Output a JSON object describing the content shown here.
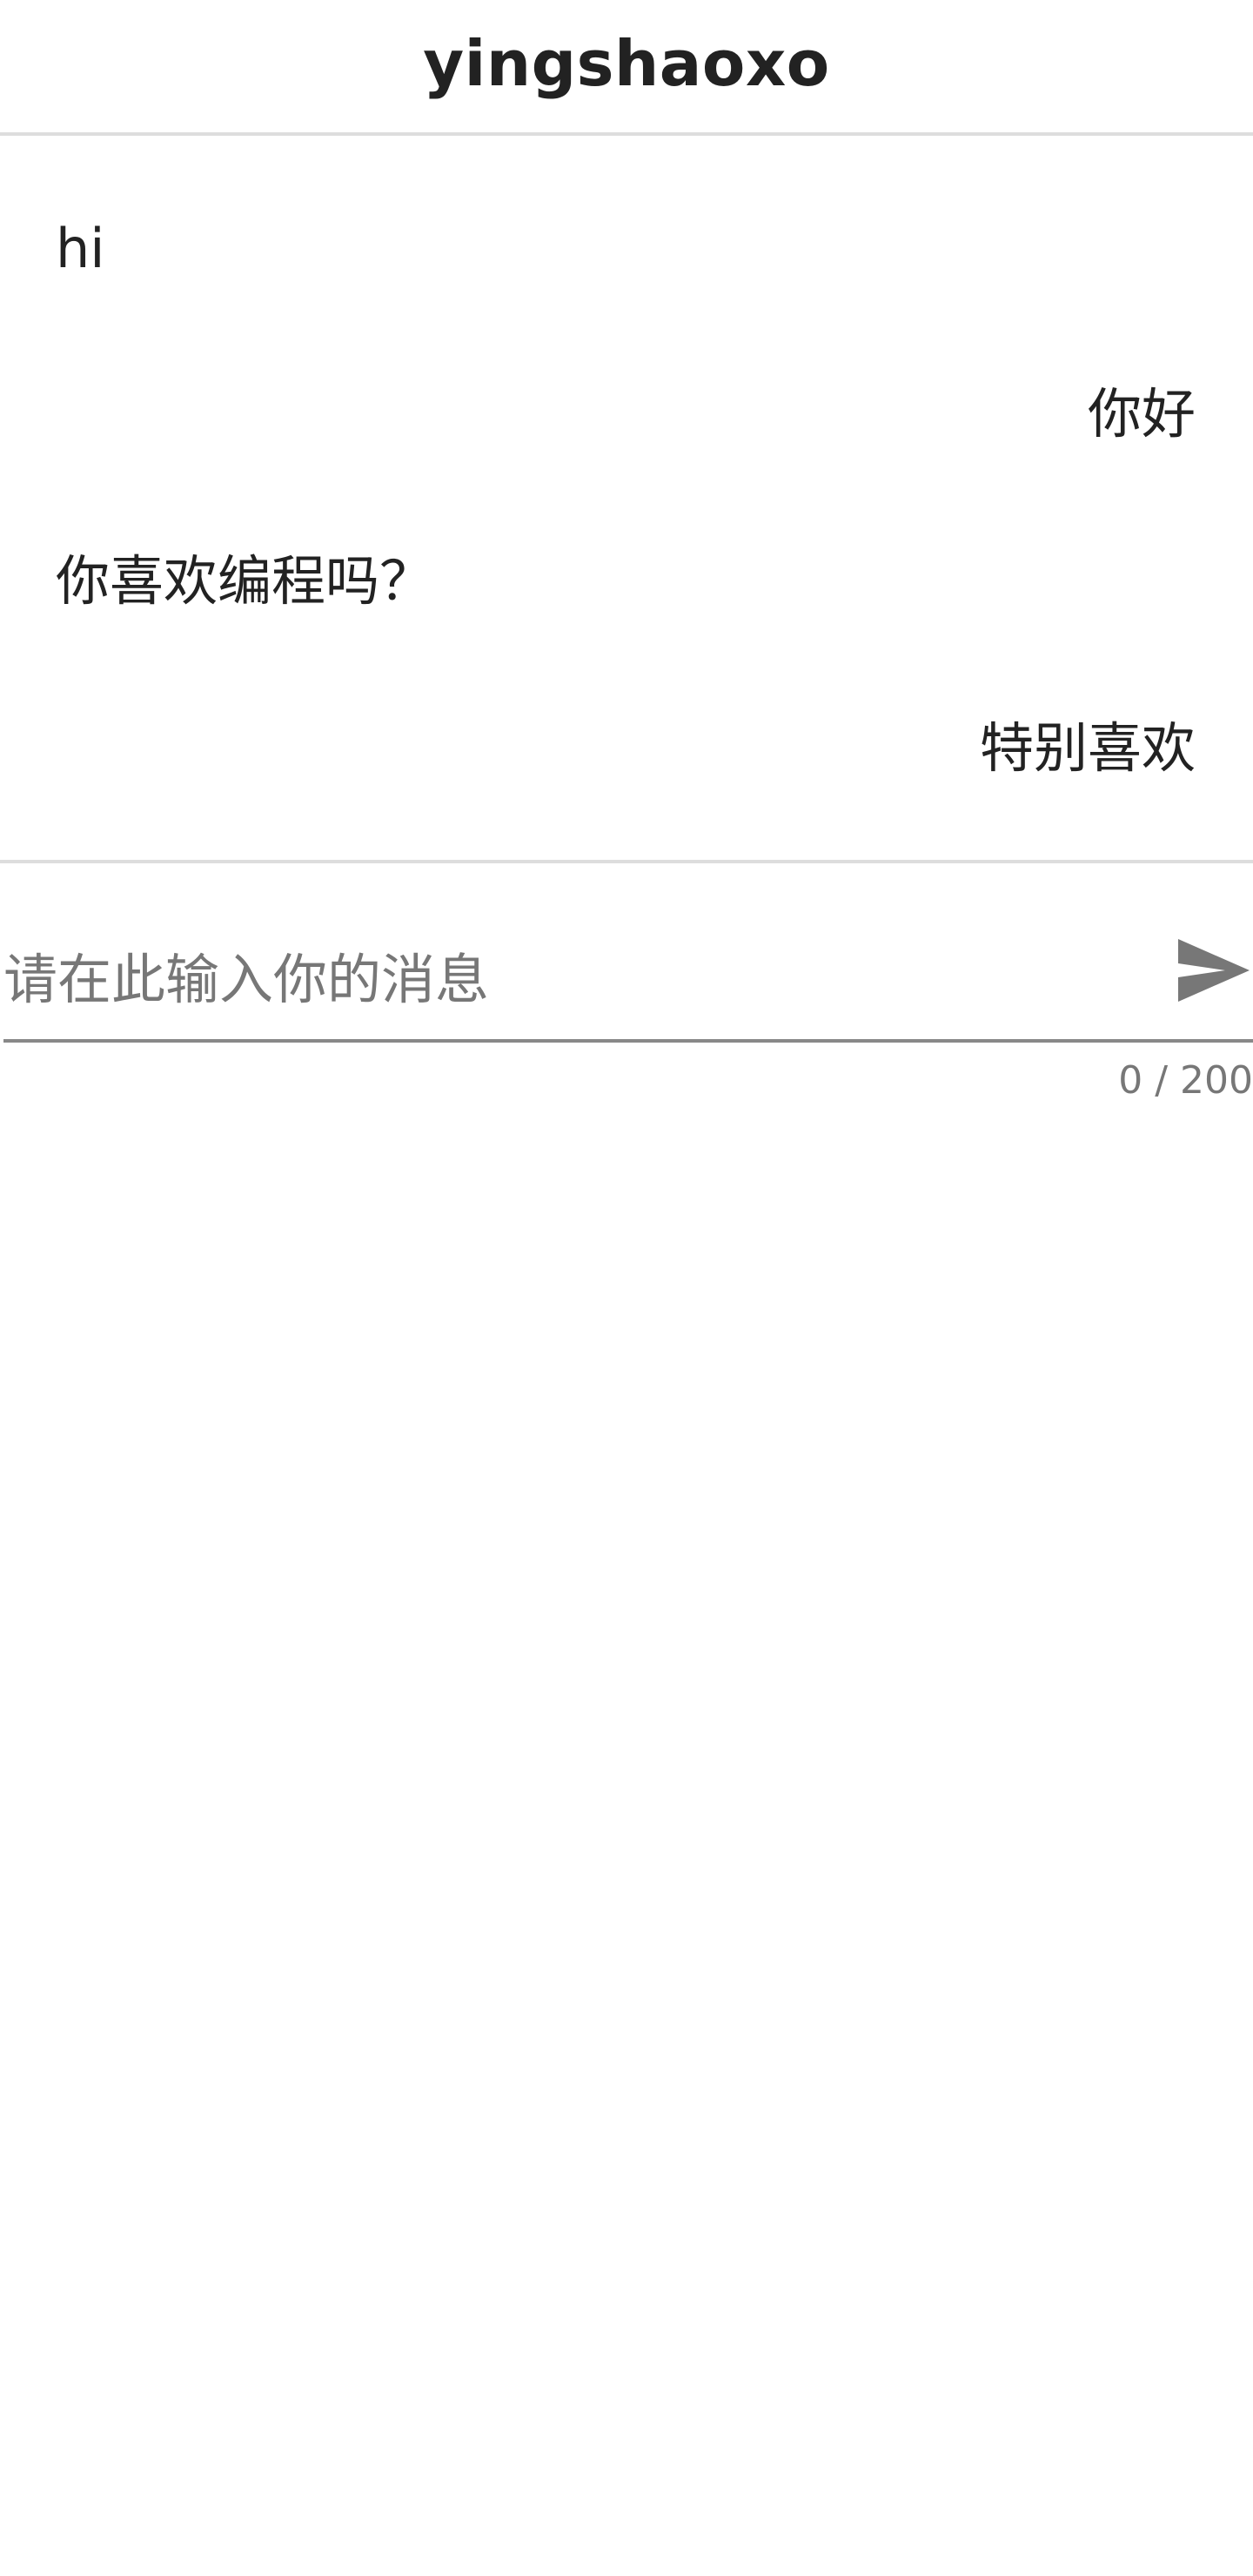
{
  "header": {
    "title": "yingshaoxo"
  },
  "messages": [
    {
      "text": "hi",
      "side": "left"
    },
    {
      "text": "你好",
      "side": "right"
    },
    {
      "text": "你喜欢编程吗？",
      "side": "left"
    },
    {
      "text": "特别喜欢",
      "side": "right"
    }
  ],
  "composer": {
    "placeholder": "请在此输入你的消息",
    "value": "",
    "counter": "0 / 200",
    "send_icon": "send-icon"
  },
  "colors": {
    "text": "#222222",
    "muted": "#777777",
    "divider": "#dddddd",
    "underline": "#888888",
    "icon": "#777777"
  }
}
